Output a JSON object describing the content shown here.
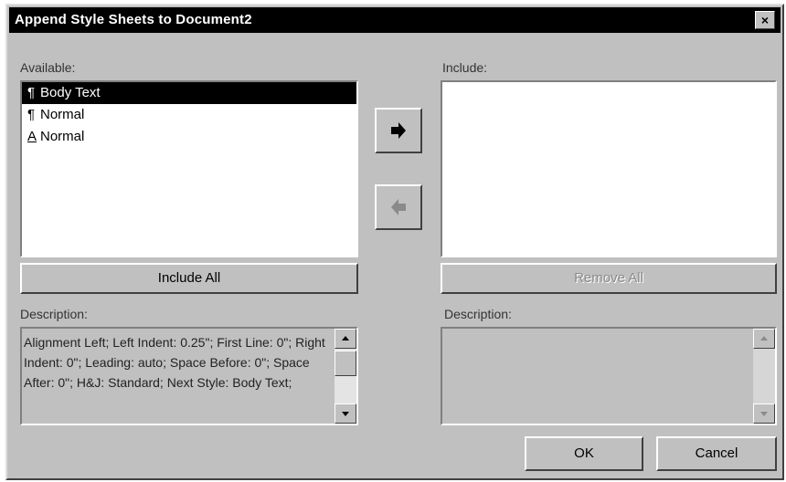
{
  "window": {
    "title": "Append Style Sheets to Document2",
    "close_label": "×"
  },
  "available": {
    "label": "Available:",
    "items": [
      {
        "icon": "pilcrow-icon",
        "glyph": "¶",
        "label": "Body Text",
        "selected": true
      },
      {
        "icon": "pilcrow-icon",
        "glyph": "¶",
        "label": "Normal",
        "selected": false
      },
      {
        "icon": "character-style-icon",
        "glyph": "A",
        "label": "Normal",
        "selected": false
      }
    ]
  },
  "include": {
    "label": "Include:",
    "items": []
  },
  "buttons": {
    "include_all": "Include All",
    "remove_all": "Remove All",
    "ok": "OK",
    "cancel": "Cancel"
  },
  "left_description": {
    "label": "Description:",
    "text": "Alignment Left;  Left Indent: 0.25\";  First Line: 0\";  Right Indent: 0\";  Leading: auto; Space Before: 0\";  Space After: 0\";  H&J: Standard;  Next Style: Body Text;"
  },
  "right_description": {
    "label": "Description:",
    "text": ""
  },
  "colors": {
    "dialog_bg": "#c0c0c0",
    "titlebar_bg": "#000000",
    "selection_bg": "#000000"
  }
}
